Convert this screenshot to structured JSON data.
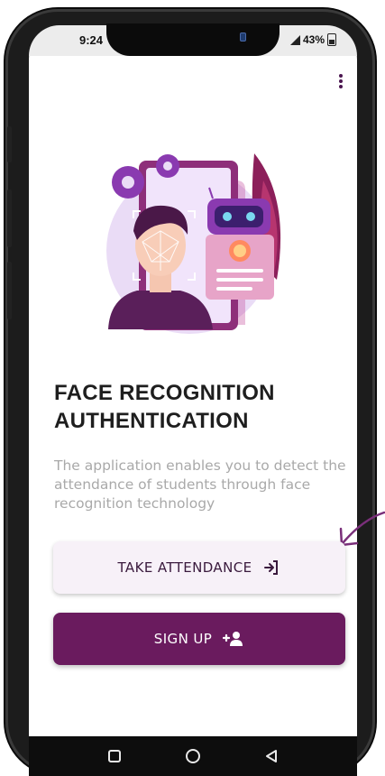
{
  "status_bar": {
    "time": "9:24",
    "battery": "43%"
  },
  "menu": {
    "icon": "more-vertical-icon"
  },
  "hero": {
    "title_line1": "FACE RECOGNITION",
    "title_line2": "AUTHENTICATION",
    "description": "The application enables you to detect the attendance of students through face recognition technology"
  },
  "actions": {
    "take_attendance": {
      "label": "TAKE ATTENDANCE",
      "icon": "login-icon"
    },
    "sign_up": {
      "label": "SIGN UP",
      "icon": "add-person-icon"
    }
  },
  "nav": {
    "items": [
      "recent-apps-icon",
      "home-icon",
      "back-icon"
    ]
  },
  "colors": {
    "primary": "#6a1b5e",
    "accent": "#7b3f8c",
    "button_light": "#f7f1f8",
    "text_dark": "#1e1e1e",
    "text_muted": "#a9a9a9"
  }
}
